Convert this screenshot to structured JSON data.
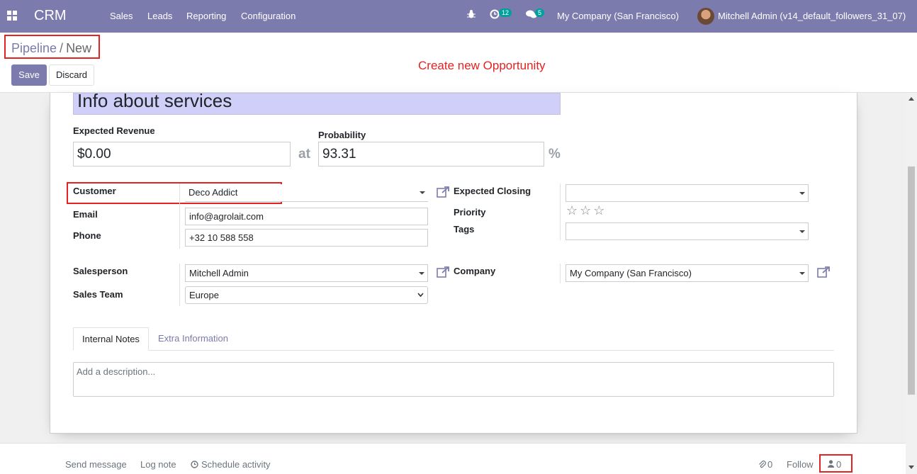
{
  "navbar": {
    "brand": "CRM",
    "menu": [
      "Sales",
      "Leads",
      "Reporting",
      "Configuration"
    ],
    "activity_count": "12",
    "message_count": "5",
    "company": "My Company (San Francisco)",
    "user": "Mitchell Admin (v14_default_followers_31_07)"
  },
  "breadcrumb": {
    "parent": "Pipeline",
    "separator": "/",
    "current": "New"
  },
  "annotation": "Create new Opportunity",
  "buttons": {
    "save": "Save",
    "discard": "Discard"
  },
  "form": {
    "title": "Info about services",
    "expected_revenue_label": "Expected Revenue",
    "expected_revenue": "$0.00",
    "at_label": "at",
    "probability_label": "Probability",
    "probability": "93.31",
    "percent_label": "%",
    "customer_label": "Customer",
    "customer": "Deco Addict",
    "email_label": "Email",
    "email": "info@agrolait.com",
    "phone_label": "Phone",
    "phone": "+32 10 588 558",
    "expected_closing_label": "Expected Closing",
    "expected_closing": "",
    "priority_label": "Priority",
    "priority_stars": "☆☆☆",
    "tags_label": "Tags",
    "tags": "",
    "salesperson_label": "Salesperson",
    "salesperson": "Mitchell Admin",
    "sales_team_label": "Sales Team",
    "sales_team": "Europe",
    "company_label": "Company",
    "company": "My Company (San Francisco)"
  },
  "tabs": [
    "Internal Notes",
    "Extra Information"
  ],
  "description_placeholder": "Add a description...",
  "chatter": {
    "send_message": "Send message",
    "log_note": "Log note",
    "schedule_activity": "Schedule activity",
    "attachments": "0",
    "follow": "Follow",
    "followers": "0"
  },
  "colors": {
    "navbar": "#7c7bad",
    "annotation": "#e32222",
    "title_bg": "#cfcff9"
  }
}
